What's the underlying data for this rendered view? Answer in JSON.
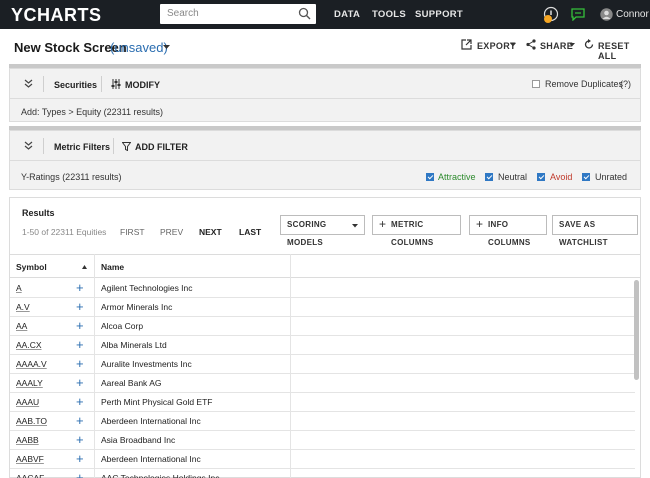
{
  "nav": {
    "logo": "YCHARTS",
    "search_placeholder": "Search",
    "links": [
      "DATA",
      "TOOLS",
      "SUPPORT"
    ],
    "user": "Connor"
  },
  "header": {
    "title": "New Stock Screen",
    "status": "(unsaved)",
    "actions": [
      "EXPORT",
      "SHARE",
      "RESET ALL"
    ]
  },
  "securities": {
    "label": "Securities",
    "modify": "MODIFY",
    "remove_duplicates": "Remove Duplicates",
    "help": "(?)",
    "summary": "Add: Types > Equity (22311 results)"
  },
  "metrics": {
    "label": "Metric Filters",
    "add_filter": "ADD FILTER",
    "summary": "Y-Ratings (22311 results)",
    "ratings": [
      {
        "label": "Attractive",
        "color": "#2e8b2e"
      },
      {
        "label": "Neutral",
        "color": "#333333"
      },
      {
        "label": "Avoid",
        "color": "#c0392b"
      },
      {
        "label": "Unrated",
        "color": "#333333"
      }
    ]
  },
  "results": {
    "label": "Results",
    "range": "1-50 of 22311 Equities",
    "pager": [
      "FIRST",
      "PREV",
      "NEXT",
      "LAST"
    ],
    "buttons": [
      "SCORING MODELS",
      "METRIC COLUMNS",
      "INFO COLUMNS",
      "SAVE AS WATCHLIST"
    ]
  },
  "table": {
    "columns": [
      "Symbol",
      "Name"
    ],
    "rows": [
      {
        "symbol": "A",
        "name": "Agilent Technologies Inc"
      },
      {
        "symbol": "A.V",
        "name": "Armor Minerals Inc"
      },
      {
        "symbol": "AA",
        "name": "Alcoa Corp"
      },
      {
        "symbol": "AA.CX",
        "name": "Alba Minerals Ltd"
      },
      {
        "symbol": "AAAA.V",
        "name": "Auralite Investments Inc"
      },
      {
        "symbol": "AAALY",
        "name": "Aareal Bank AG"
      },
      {
        "symbol": "AAAU",
        "name": "Perth Mint Physical Gold ETF"
      },
      {
        "symbol": "AAB.TO",
        "name": "Aberdeen International Inc"
      },
      {
        "symbol": "AABB",
        "name": "Asia Broadband Inc"
      },
      {
        "symbol": "AABVF",
        "name": "Aberdeen International Inc"
      },
      {
        "symbol": "AACAF",
        "name": "AAC Technologies Holdings Inc"
      }
    ]
  },
  "colors": {
    "nav_bg": "#1b1f24",
    "accent": "#2a6db0",
    "notify": "#f5a623",
    "chat": "#35c13a"
  }
}
